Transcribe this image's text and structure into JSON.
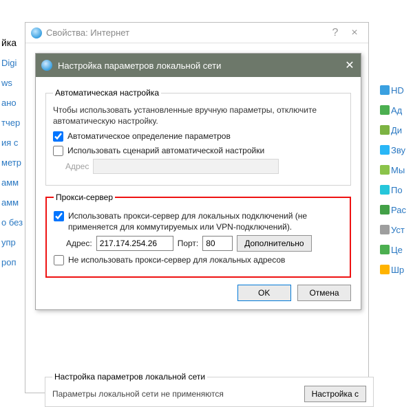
{
  "bg_left": {
    "header": "йка",
    "items": [
      "Digi",
      "ws",
      "aно",
      "тчер",
      "ия с",
      "метр",
      "амм",
      "амм",
      "о без",
      "упр",
      "роп"
    ]
  },
  "bg_right": [
    {
      "label": "HD",
      "color": "#3aa0e0"
    },
    {
      "label": "Ад",
      "color": "#4caf50"
    },
    {
      "label": "Ди",
      "color": "#7cb342"
    },
    {
      "label": "Зву",
      "color": "#29b6f6"
    },
    {
      "label": "Мы",
      "color": "#8bc34a"
    },
    {
      "label": "По",
      "color": "#26c6da"
    },
    {
      "label": "Рас",
      "color": "#43a047"
    },
    {
      "label": "Уст",
      "color": "#9e9e9e"
    },
    {
      "label": "Це",
      "color": "#4caf50"
    },
    {
      "label": "Шр",
      "color": "#ffb300"
    }
  ],
  "propwin": {
    "title": "Свойства: Интернет",
    "help": "?",
    "close": "×"
  },
  "lanwin": {
    "title": "Настройка параметров локальной сети",
    "close": "✕"
  },
  "auto": {
    "legend": "Автоматическая настройка",
    "hint": "Чтобы использовать установленные вручную параметры, отключите автоматическую настройку.",
    "auto_detect": "Автоматическое определение параметров",
    "use_script": "Использовать сценарий автоматической настройки",
    "addr_label": "Адрес",
    "addr_value": ""
  },
  "proxy": {
    "legend": "Прокси-сервер",
    "use_proxy": "Использовать прокси-сервер для локальных подключений (не применяется для коммутируемых или VPN-подключений).",
    "addr_label": "Адрес:",
    "addr_value": "217.174.254.26",
    "port_label": "Порт:",
    "port_value": "80",
    "advanced": "Дополнительно",
    "bypass_local": "Не использовать прокси-сервер для локальных адресов"
  },
  "buttons": {
    "ok": "OK",
    "cancel": "Отмена"
  },
  "bottom": {
    "legend": "Настройка параметров локальной сети",
    "text": "Параметры локальной сети не применяются",
    "btn": "Настройка с"
  }
}
